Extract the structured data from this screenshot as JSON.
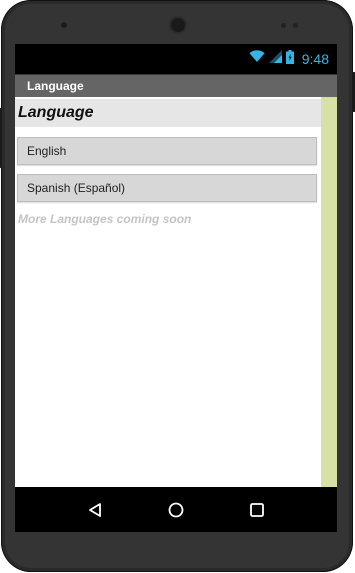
{
  "status_bar": {
    "time": "9:48",
    "icons": [
      "wifi-icon",
      "signal-icon",
      "battery-icon"
    ]
  },
  "title_bar": {
    "title": "Language"
  },
  "screen": {
    "heading": "Language",
    "buttons": [
      {
        "label": "English"
      },
      {
        "label": "Spanish (Español)"
      }
    ],
    "note": "More Languages coming soon"
  },
  "nav_bar": {
    "icons": [
      "back-triangle-icon",
      "home-circle-icon",
      "recents-square-icon"
    ]
  },
  "colors": {
    "status_accent": "#33b5e5",
    "title_bar_bg": "#656565",
    "side_bar": "#d7e1a5"
  }
}
